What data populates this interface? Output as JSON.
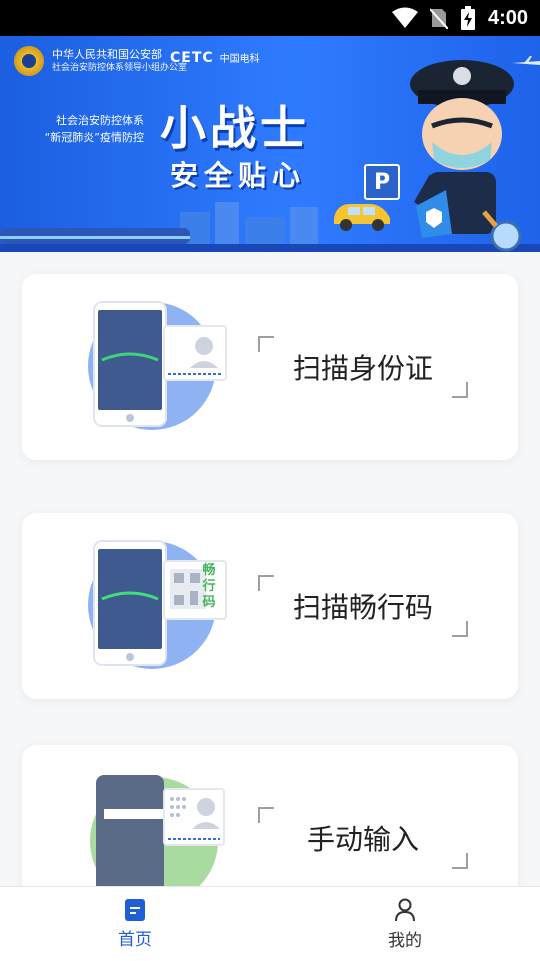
{
  "status_bar": {
    "time": "4:00",
    "icons": [
      "wifi-icon",
      "no-sim-icon",
      "battery-charging-icon"
    ]
  },
  "banner": {
    "org_line1": "中华人民共和国公安部",
    "org_line2": "社会治安防控体系领导小组办公室",
    "cetc_logo": "CETC",
    "cetc_name": "中国电科",
    "slogan_line1": "社会治安防控体系",
    "slogan_line2": "“新冠肺炎”疫情防控",
    "title": "小战士",
    "subtitle": "安全贴心",
    "parking_sign": "P"
  },
  "cards": [
    {
      "label": "扫描身份证",
      "icon": "id-card-scan-icon"
    },
    {
      "label": "扫描畅行码",
      "icon": "travel-code-scan-icon",
      "badge": "畅行码"
    },
    {
      "label": "手动输入",
      "icon": "manual-input-icon"
    }
  ],
  "tabbar": {
    "home_label": "首页",
    "mine_label": "我的"
  },
  "colors": {
    "accent": "#1f5fd6",
    "banner_blue": "#2f7bff",
    "illus_blue": "#8fb3f2",
    "illus_green": "#a9dba0"
  }
}
